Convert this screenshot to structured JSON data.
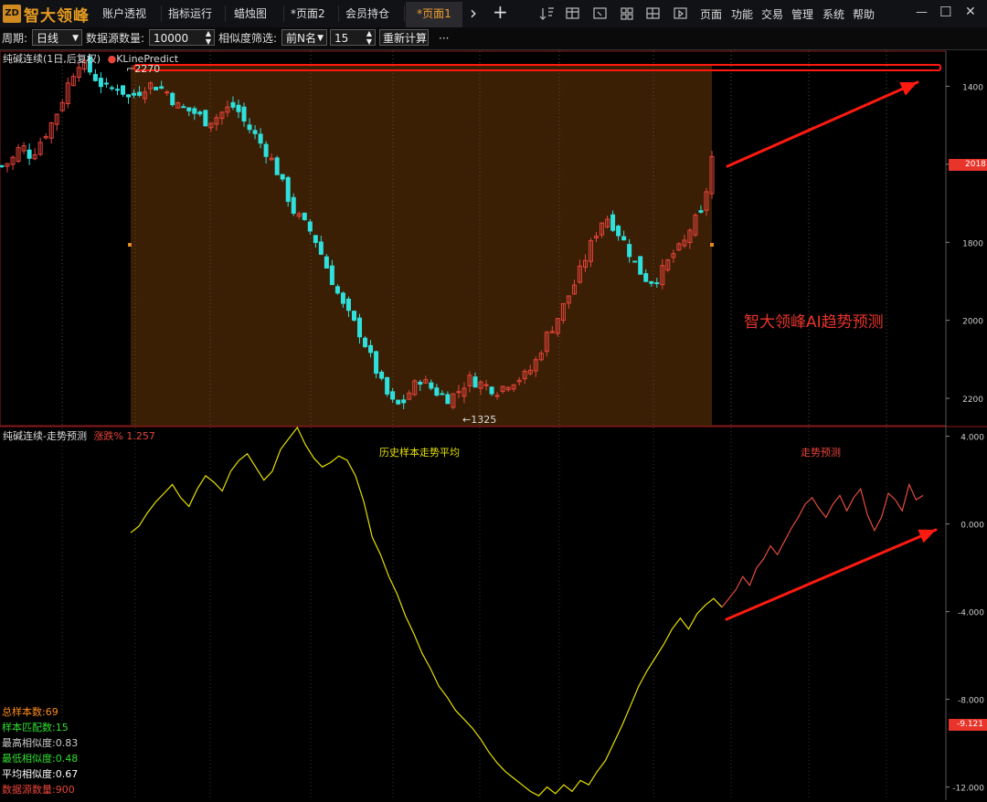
{
  "app": {
    "logo_text": "智大领峰",
    "logo_mark": "ZD"
  },
  "tabs": [
    {
      "label": "账户透视",
      "active": false
    },
    {
      "label": "指标运行",
      "active": false
    },
    {
      "label": "蜡烛图",
      "active": false
    },
    {
      "label": "*页面2",
      "active": false
    },
    {
      "label": "会员持仓",
      "active": false
    },
    {
      "label": "*页面1",
      "active": true
    }
  ],
  "tab_controls": {
    "next": "›",
    "add": "+"
  },
  "menu": [
    "页面",
    "功能",
    "交易",
    "管理",
    "系统",
    "帮助"
  ],
  "window_controls": {
    "minimize": "—",
    "maximize": "☐",
    "close": "✕"
  },
  "toolbar": {
    "period_label": "周期:",
    "period_value": "日线",
    "source_label": "数据源数量:",
    "source_value": "10000",
    "filter_label": "相似度筛选:",
    "filter_value": "前N名",
    "filter_n": "15",
    "recalc": "重新计算",
    "more": "···"
  },
  "colors": {
    "up": "#e8443a",
    "down": "#2fe0dc",
    "highlight_bg": "#3a1f05",
    "line": "#e6e000",
    "predict": "#e34c3c",
    "arrow": "#ff1a10",
    "border": "#8a1a1a"
  },
  "kline_panel": {
    "title": "纯碱连续(1日,后复权)",
    "indicator": "KLinePredict",
    "high_label": "2270",
    "low_label": "1325",
    "price_tag": "2018",
    "y_ticks": [
      "2200",
      "2000",
      "1800",
      "1600",
      "1400"
    ],
    "annotation": "智大领峰AI趋势预测"
  },
  "trend_panel": {
    "title": "纯碱连续-走势预测",
    "change_label": "涨跌%",
    "change_value": "1.257",
    "hist_label": "历史样本走势平均",
    "predict_label": "走势预测",
    "y_ticks": [
      "4.000",
      "0.000",
      "-4.000",
      "-8.000",
      "-12.000"
    ],
    "value_tag": "-9.121"
  },
  "stats": [
    {
      "label": "总样本数",
      "value": "69",
      "color": "#ff8c1a"
    },
    {
      "label": "样本匹配数",
      "value": "15",
      "color": "#2fe02f"
    },
    {
      "label": "最高相似度",
      "value": "0.83",
      "color": "#cccccc"
    },
    {
      "label": "最低相似度",
      "value": "0.48",
      "color": "#2fe02f"
    },
    {
      "label": "平均相似度",
      "value": "0.67",
      "color": "#ffffff"
    },
    {
      "label": "数据源数量",
      "value": "900",
      "color": "#e8443a"
    }
  ],
  "chart_data": [
    {
      "type": "candlestick",
      "title": "纯碱连续(1日,后复权)",
      "ylim": [
        1330,
        2290
      ],
      "y_ticks": [
        1400,
        1600,
        1800,
        2000,
        2200
      ],
      "close_path": [
        1995,
        2010,
        2050,
        2020,
        2060,
        2100,
        2150,
        2220,
        2265,
        2240,
        2210,
        2190,
        2200,
        2170,
        2185,
        2205,
        2200,
        2185,
        2150,
        2140,
        2130,
        2110,
        2120,
        2140,
        2150,
        2105,
        2075,
        2040,
        2000,
        1940,
        1880,
        1850,
        1820,
        1760,
        1700,
        1640,
        1600,
        1560,
        1500,
        1440,
        1390,
        1380,
        1420,
        1450,
        1430,
        1410,
        1400,
        1420,
        1450,
        1440,
        1430,
        1420,
        1440,
        1450,
        1460,
        1500,
        1560,
        1600,
        1650,
        1700,
        1760,
        1820,
        1870,
        1840,
        1800,
        1750,
        1710,
        1700,
        1730,
        1770,
        1790,
        1850,
        1870,
        2018
      ],
      "candle_count": 130,
      "history_range_fraction": [
        0.18,
        1.0
      ]
    },
    {
      "type": "line",
      "title": "纯碱连续-走势预测",
      "ylim": [
        -12.6,
        4.4
      ],
      "y_ticks": [
        4,
        0,
        -4,
        -8,
        -12
      ],
      "series": [
        {
          "values": [
            -0.4,
            -0.1,
            0.5,
            1.0,
            1.4,
            1.8,
            1.2,
            0.8,
            1.6,
            2.2,
            1.9,
            1.5,
            2.4,
            2.9,
            3.2,
            2.6,
            2.0,
            2.4,
            3.4,
            3.9,
            4.4,
            3.6,
            3.0,
            2.6,
            2.8,
            3.1,
            2.9,
            2.2,
            1.0,
            -0.6,
            -1.4,
            -2.4,
            -3.2,
            -4.2,
            -5.0,
            -5.9,
            -6.6,
            -7.4,
            -7.9,
            -8.5,
            -8.9,
            -9.3,
            -9.8,
            -10.4,
            -10.9,
            -11.3,
            -11.6,
            -11.9,
            -12.2,
            -12.4,
            -12.0,
            -12.3,
            -11.9,
            -12.2,
            -11.7,
            -11.9,
            -11.3,
            -10.8,
            -10.0,
            -9.2,
            -8.3,
            -7.4,
            -6.7,
            -6.1,
            -5.5,
            -4.8,
            -4.3,
            -4.8,
            -4.1,
            -3.7,
            -3.4,
            -3.8
          ]
        },
        {
          "values": [
            -3.8,
            -3.4,
            -3.0,
            -2.4,
            -2.8,
            -2.0,
            -1.6,
            -1.0,
            -1.4,
            -0.8,
            -0.2,
            0.3,
            0.9,
            1.2,
            0.7,
            0.3,
            0.9,
            1.3,
            0.6,
            1.2,
            1.6,
            0.4,
            -0.3,
            0.3,
            1.4,
            1.1,
            0.6,
            1.8,
            1.1,
            1.3
          ]
        }
      ]
    }
  ]
}
